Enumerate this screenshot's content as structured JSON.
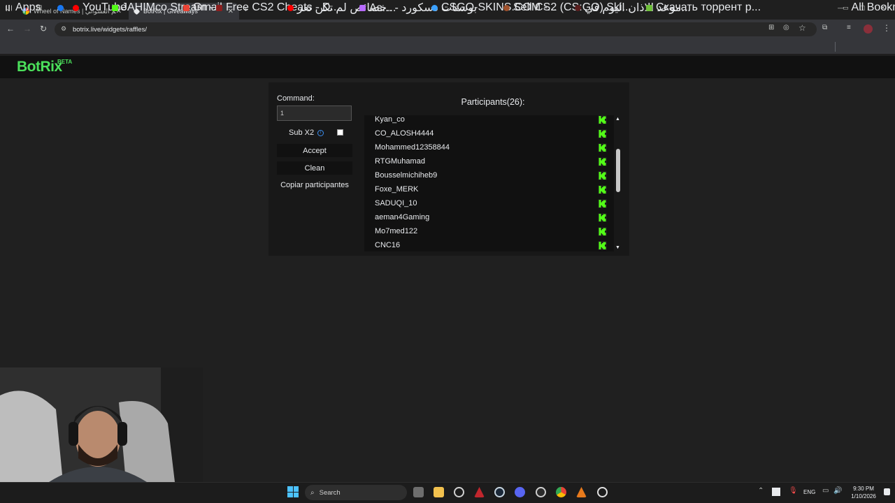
{
  "browser": {
    "tabs": [
      {
        "title": "Wheel of Names | أسم العشوائي",
        "active": false
      },
      {
        "title": "BotRix | Giveaways",
        "active": true
      }
    ],
    "new_tab": "+",
    "url": "botrix.live/widgets/raffles/",
    "bookmarks": [
      {
        "label": "Apps",
        "color": "#bbbbbb"
      },
      {
        "label": "",
        "color": "#1877f2"
      },
      {
        "label": "YouTube",
        "color": "#ff0000"
      },
      {
        "label": "JAHIMco Stream -...",
        "color": "#53fc18"
      },
      {
        "label": "Gmail",
        "color": "#ea4335"
      },
      {
        "label": "Free CS2 Cheats - D...",
        "color": "#8b1e1e"
      },
      {
        "label": "خصائص لم تكن تعر...",
        "color": "#ff0000"
      },
      {
        "label": "As... - بوستات دسكورد",
        "color": "#b86bff"
      },
      {
        "label": "CSGO-SKINS.COM -...",
        "color": "#3aa0ff"
      },
      {
        "label": "Sell CS2 (CS:GO) Ski...",
        "color": "#a0522d"
      },
      {
        "label": "موعد الاذان اليوم في...",
        "color": "#5a1e1e"
      },
      {
        "label": "Скачать торрент р...",
        "color": "#6fbf3a"
      }
    ],
    "all_bookmarks": "All Bookmarks"
  },
  "site": {
    "logo": "BotRix",
    "logo_badge": "BETA"
  },
  "raffle": {
    "command_label": "Command:",
    "command_value": "1",
    "sub_x2_label": "Sub X2",
    "info_icon": "i",
    "accept_label": "Accept",
    "clean_label": "Clean",
    "copy_label": "Copiar participantes",
    "participants_title": "Participants(26):",
    "participants": [
      "Kyan_co",
      "CO_ALOSH4444",
      "Mohammed12358844",
      "RTGMuhamad",
      "Bousselmichiheb9",
      "Foxe_MERK",
      "SADUQI_10",
      "aeman4Gaming",
      "Mo7med122",
      "CNC16"
    ],
    "platform_icon": "kick-icon",
    "platform_color": "#53fc18"
  },
  "taskbar": {
    "search_label": "Search",
    "lang": "ENG",
    "time": "9:30 PM",
    "date": "1/10/2026"
  }
}
